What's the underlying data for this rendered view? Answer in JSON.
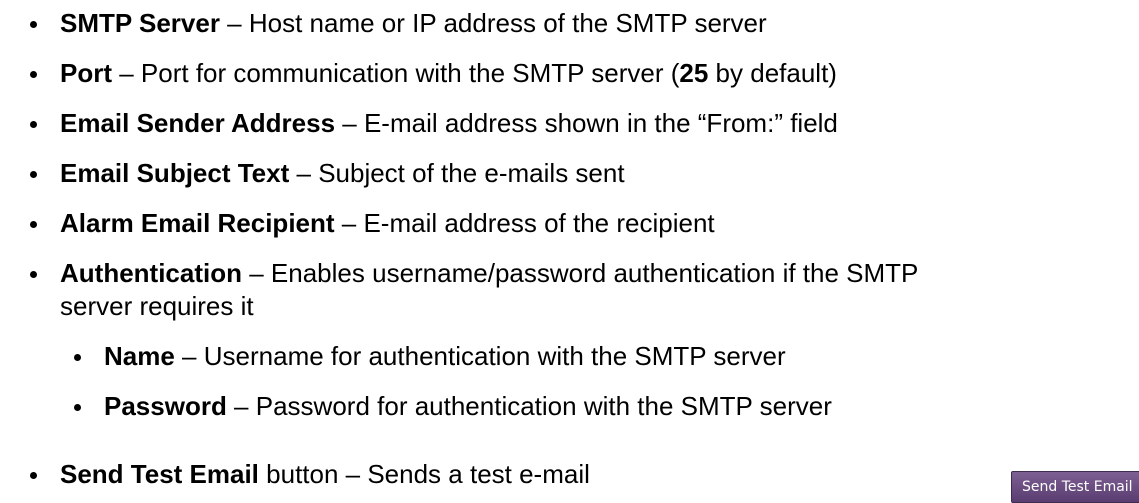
{
  "items": [
    {
      "term": "SMTP Server",
      "sep": " – ",
      "desc": "Host name or IP address of the SMTP server"
    },
    {
      "term": "Port",
      "sep": " – ",
      "desc_a": "Port for communication with the SMTP server (",
      "desc_bold": "25",
      "desc_b": " by default)"
    },
    {
      "term": "Email Sender Address",
      "sep": " – ",
      "desc": "E-mail address shown in the “From:” field"
    },
    {
      "term": "Email Subject Text",
      "sep": " – ",
      "desc": "Subject of the e-mails sent"
    },
    {
      "term": "Alarm Email Recipient",
      "sep": " – ",
      "desc": "E-mail address of the recipient"
    },
    {
      "term": "Authentication",
      "sep": " – ",
      "desc": "Enables username/password authentication if the SMTP",
      "desc_cont": "server requires it"
    },
    {
      "term": "Name",
      "sep": " – ",
      "desc": "Username for authentication with the SMTP server"
    },
    {
      "term": "Password",
      "sep": " – ",
      "desc": "Password for authentication with the SMTP server"
    },
    {
      "term": "Send Test Email",
      "desc": " button – Sends a test e-mail"
    }
  ],
  "test_button": {
    "label": "Send Test Email"
  }
}
